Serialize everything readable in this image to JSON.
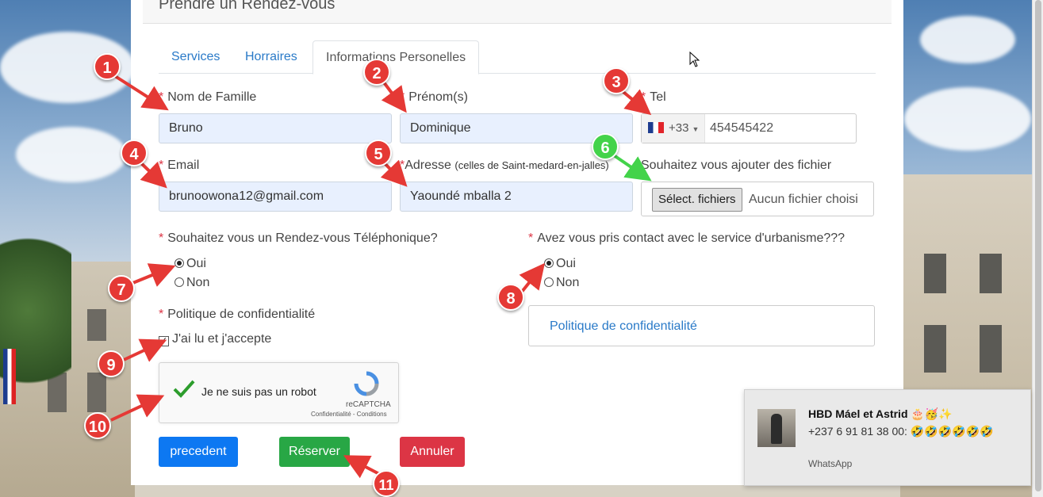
{
  "panel": {
    "title": "Prendre un Rendez-vous"
  },
  "tabs": [
    {
      "label": "Services"
    },
    {
      "label": "Horraires"
    },
    {
      "label": "Informations Personelles"
    }
  ],
  "form": {
    "nom": {
      "label": "Nom de Famille",
      "value": "Bruno"
    },
    "prenom": {
      "label": "Prénom(s)",
      "value": "Dominique"
    },
    "tel": {
      "label": "Tel",
      "country_code": "+33",
      "value": "454545422"
    },
    "email": {
      "label": "Email",
      "value": "brunoowona12@gmail.com"
    },
    "adresse": {
      "label": "Adresse",
      "hint": "(celles de Saint-medard-en-jalles)",
      "value": "Yaoundé mballa 2"
    },
    "fichier": {
      "label": "Souhaitez vous ajouter des fichier",
      "button": "Sélect. fichiers",
      "status": "Aucun fichier choisi"
    },
    "rdv_tel": {
      "label": "Souhaitez vous un Rendez-vous Téléphonique?",
      "yes": "Oui",
      "no": "Non",
      "selected": "Oui"
    },
    "urbanisme": {
      "label": "Avez vous pris contact avec le service d'urbanisme???",
      "yes": "Oui",
      "no": "Non",
      "selected": "Oui"
    },
    "politique": {
      "label": "Politique de confidentialité",
      "checkbox": "J'ai lu et j'accepte",
      "checked": true,
      "link": "Politique de confidentialité"
    },
    "required_mark": "*"
  },
  "captcha": {
    "text": "Je ne suis pas un robot",
    "brand": "reCAPTCHA",
    "terms": "Confidentialité - Conditions"
  },
  "buttons": {
    "prev": "precedent",
    "reserve": "Réserver",
    "cancel": "Annuler"
  },
  "colors": {
    "prev": "#0d78f2",
    "reserve": "#28a745",
    "cancel": "#dc3545",
    "annotation": "#e53935",
    "annotation_alt": "#43d34a"
  },
  "annotations": [
    "1",
    "2",
    "3",
    "4",
    "5",
    "6",
    "7",
    "8",
    "9",
    "10",
    "11"
  ],
  "notification": {
    "title": "HBD Máel et Astrid 🎂🥳✨",
    "message": "+237 6 91 81 38 00: 🤣🤣🤣🤣🤣🤣",
    "app": "WhatsApp"
  }
}
